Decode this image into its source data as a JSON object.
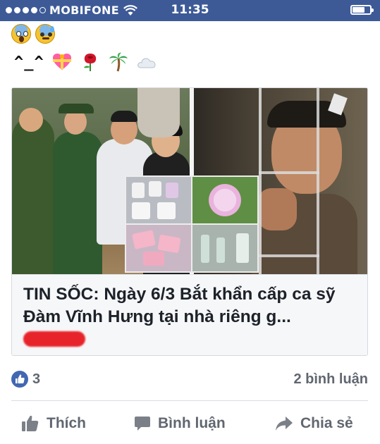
{
  "status_bar": {
    "carrier": "MOBIFONE",
    "time": "11:35",
    "signal_bars": 4,
    "signal_total": 5,
    "battery_level": 0.7
  },
  "post": {
    "emoji_line_1": [
      "face-screaming-in-fear",
      "anxious-face-with-sweat"
    ],
    "kaomoji": "^_^",
    "emoji_line_2": [
      "heart-with-ribbon",
      "rose",
      "palm-tree",
      "cloud"
    ]
  },
  "link_card": {
    "headline": "TIN SỐC: Ngày 6/3 Bắt khẩn cấp ca sỹ Đàm Vĩnh Hưng tại nhà riêng g..."
  },
  "reactions": {
    "like_count": "3",
    "comments": "2 bình luận"
  },
  "actions": {
    "like": "Thích",
    "comment": "Bình luận",
    "share": "Chia sẻ"
  },
  "colors": {
    "status_bar": "#3d5a97",
    "fb_blue": "#4267b2",
    "meta_gray": "#616770",
    "redaction": "#e8242b"
  }
}
